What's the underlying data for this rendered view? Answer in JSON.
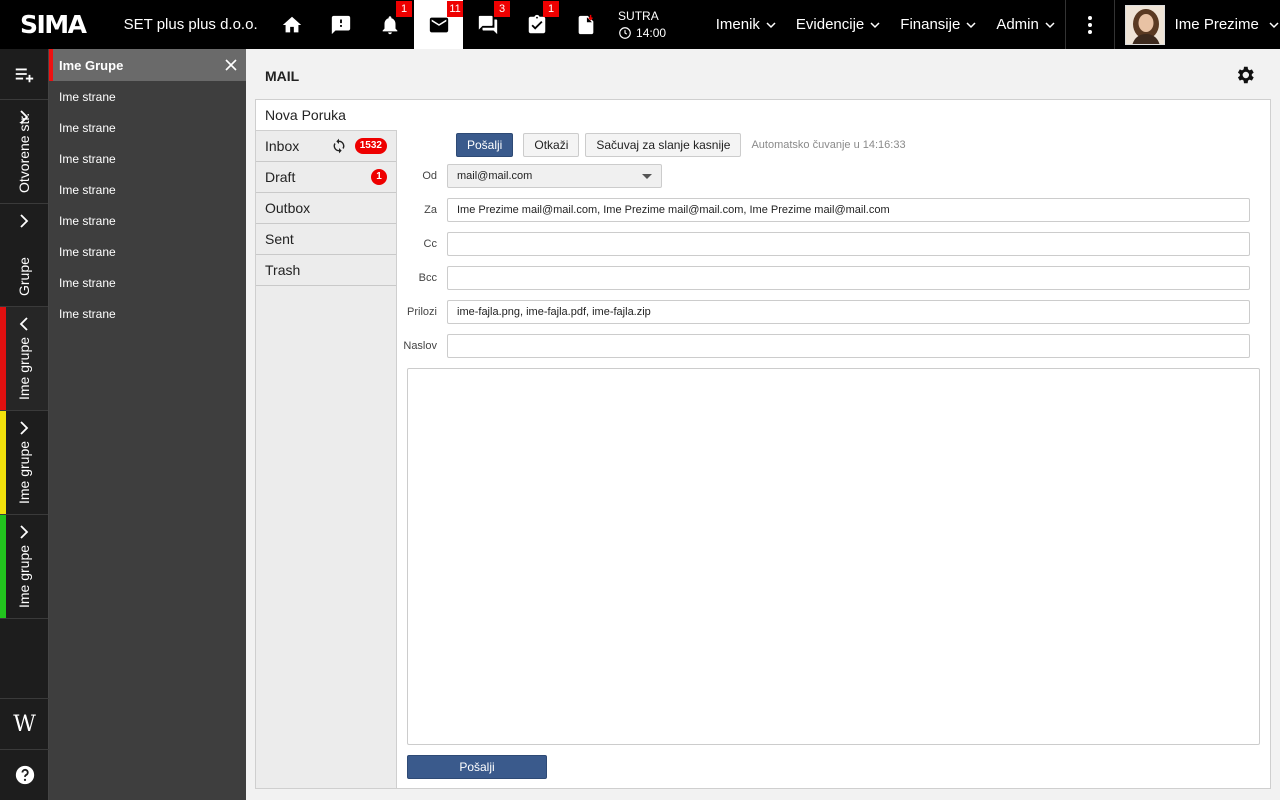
{
  "app": {
    "logo": "SIMA",
    "company": "SET plus plus d.o.o.",
    "colors": {
      "accent": "#3a5a8c",
      "badge": "#e00000",
      "topbar": "#000000"
    }
  },
  "topbar": {
    "icons": [
      {
        "name": "home-icon",
        "badge": ""
      },
      {
        "name": "alert-icon",
        "badge": ""
      },
      {
        "name": "bell-icon",
        "badge": "1"
      },
      {
        "name": "mail-icon",
        "badge": "11",
        "active": true
      },
      {
        "name": "chat-icon",
        "badge": "3"
      },
      {
        "name": "task-icon",
        "badge": "1"
      },
      {
        "name": "document-icon",
        "badge": ""
      }
    ],
    "deadline": {
      "label": "SUTRA",
      "time": "14:00"
    },
    "nav": [
      "Imenik",
      "Evidencije",
      "Finansije",
      "Admin"
    ],
    "user": {
      "name": "Ime Prezime"
    }
  },
  "rail": {
    "sections": [
      {
        "label": "Otvorene str.",
        "stripe": ""
      },
      {
        "label": "Grupe",
        "stripe": ""
      },
      {
        "label": "Ime grupe",
        "stripe": "#e01010"
      },
      {
        "label": "Ime grupe",
        "stripe": "#f2e10c"
      },
      {
        "label": "Ime grupe",
        "stripe": "#22c41e"
      }
    ],
    "bottom": {
      "wiki": "W"
    }
  },
  "pages": {
    "header": "Ime Grupe",
    "items": [
      "Ime strane",
      "Ime strane",
      "Ime strane",
      "Ime strane",
      "Ime strane",
      "Ime strane",
      "Ime strane",
      "Ime strane"
    ]
  },
  "main": {
    "title": "MAIL",
    "tab": "Nova Poruka",
    "folders": [
      {
        "label": "Inbox",
        "badge": "1532",
        "sync": true
      },
      {
        "label": "Draft",
        "badge": "1",
        "sync": false
      },
      {
        "label": "Outbox",
        "badge": "",
        "sync": false
      },
      {
        "label": "Sent",
        "badge": "",
        "sync": false
      },
      {
        "label": "Trash",
        "badge": "",
        "sync": false
      }
    ],
    "compose": {
      "send": "Pošalji",
      "cancel": "Otkaži",
      "save_later": "Sačuvaj za slanje kasnije",
      "autosave": "Automatsko čuvanje u 14:16:33",
      "from_label": "Od",
      "from_value": "mail@mail.com",
      "to_label": "Za",
      "to_value": "Ime Prezime mail@mail.com, Ime Prezime mail@mail.com, Ime Prezime mail@mail.com",
      "cc_label": "Cc",
      "cc_value": "",
      "bcc_label": "Bcc",
      "bcc_value": "",
      "attach_label": "Prilozi",
      "attach_value": "ime-fajla.png, ime-fajla.pdf, ime-fajla.zip",
      "subject_label": "Naslov",
      "subject_value": "",
      "body": "",
      "send_bottom": "Pošalji"
    }
  }
}
